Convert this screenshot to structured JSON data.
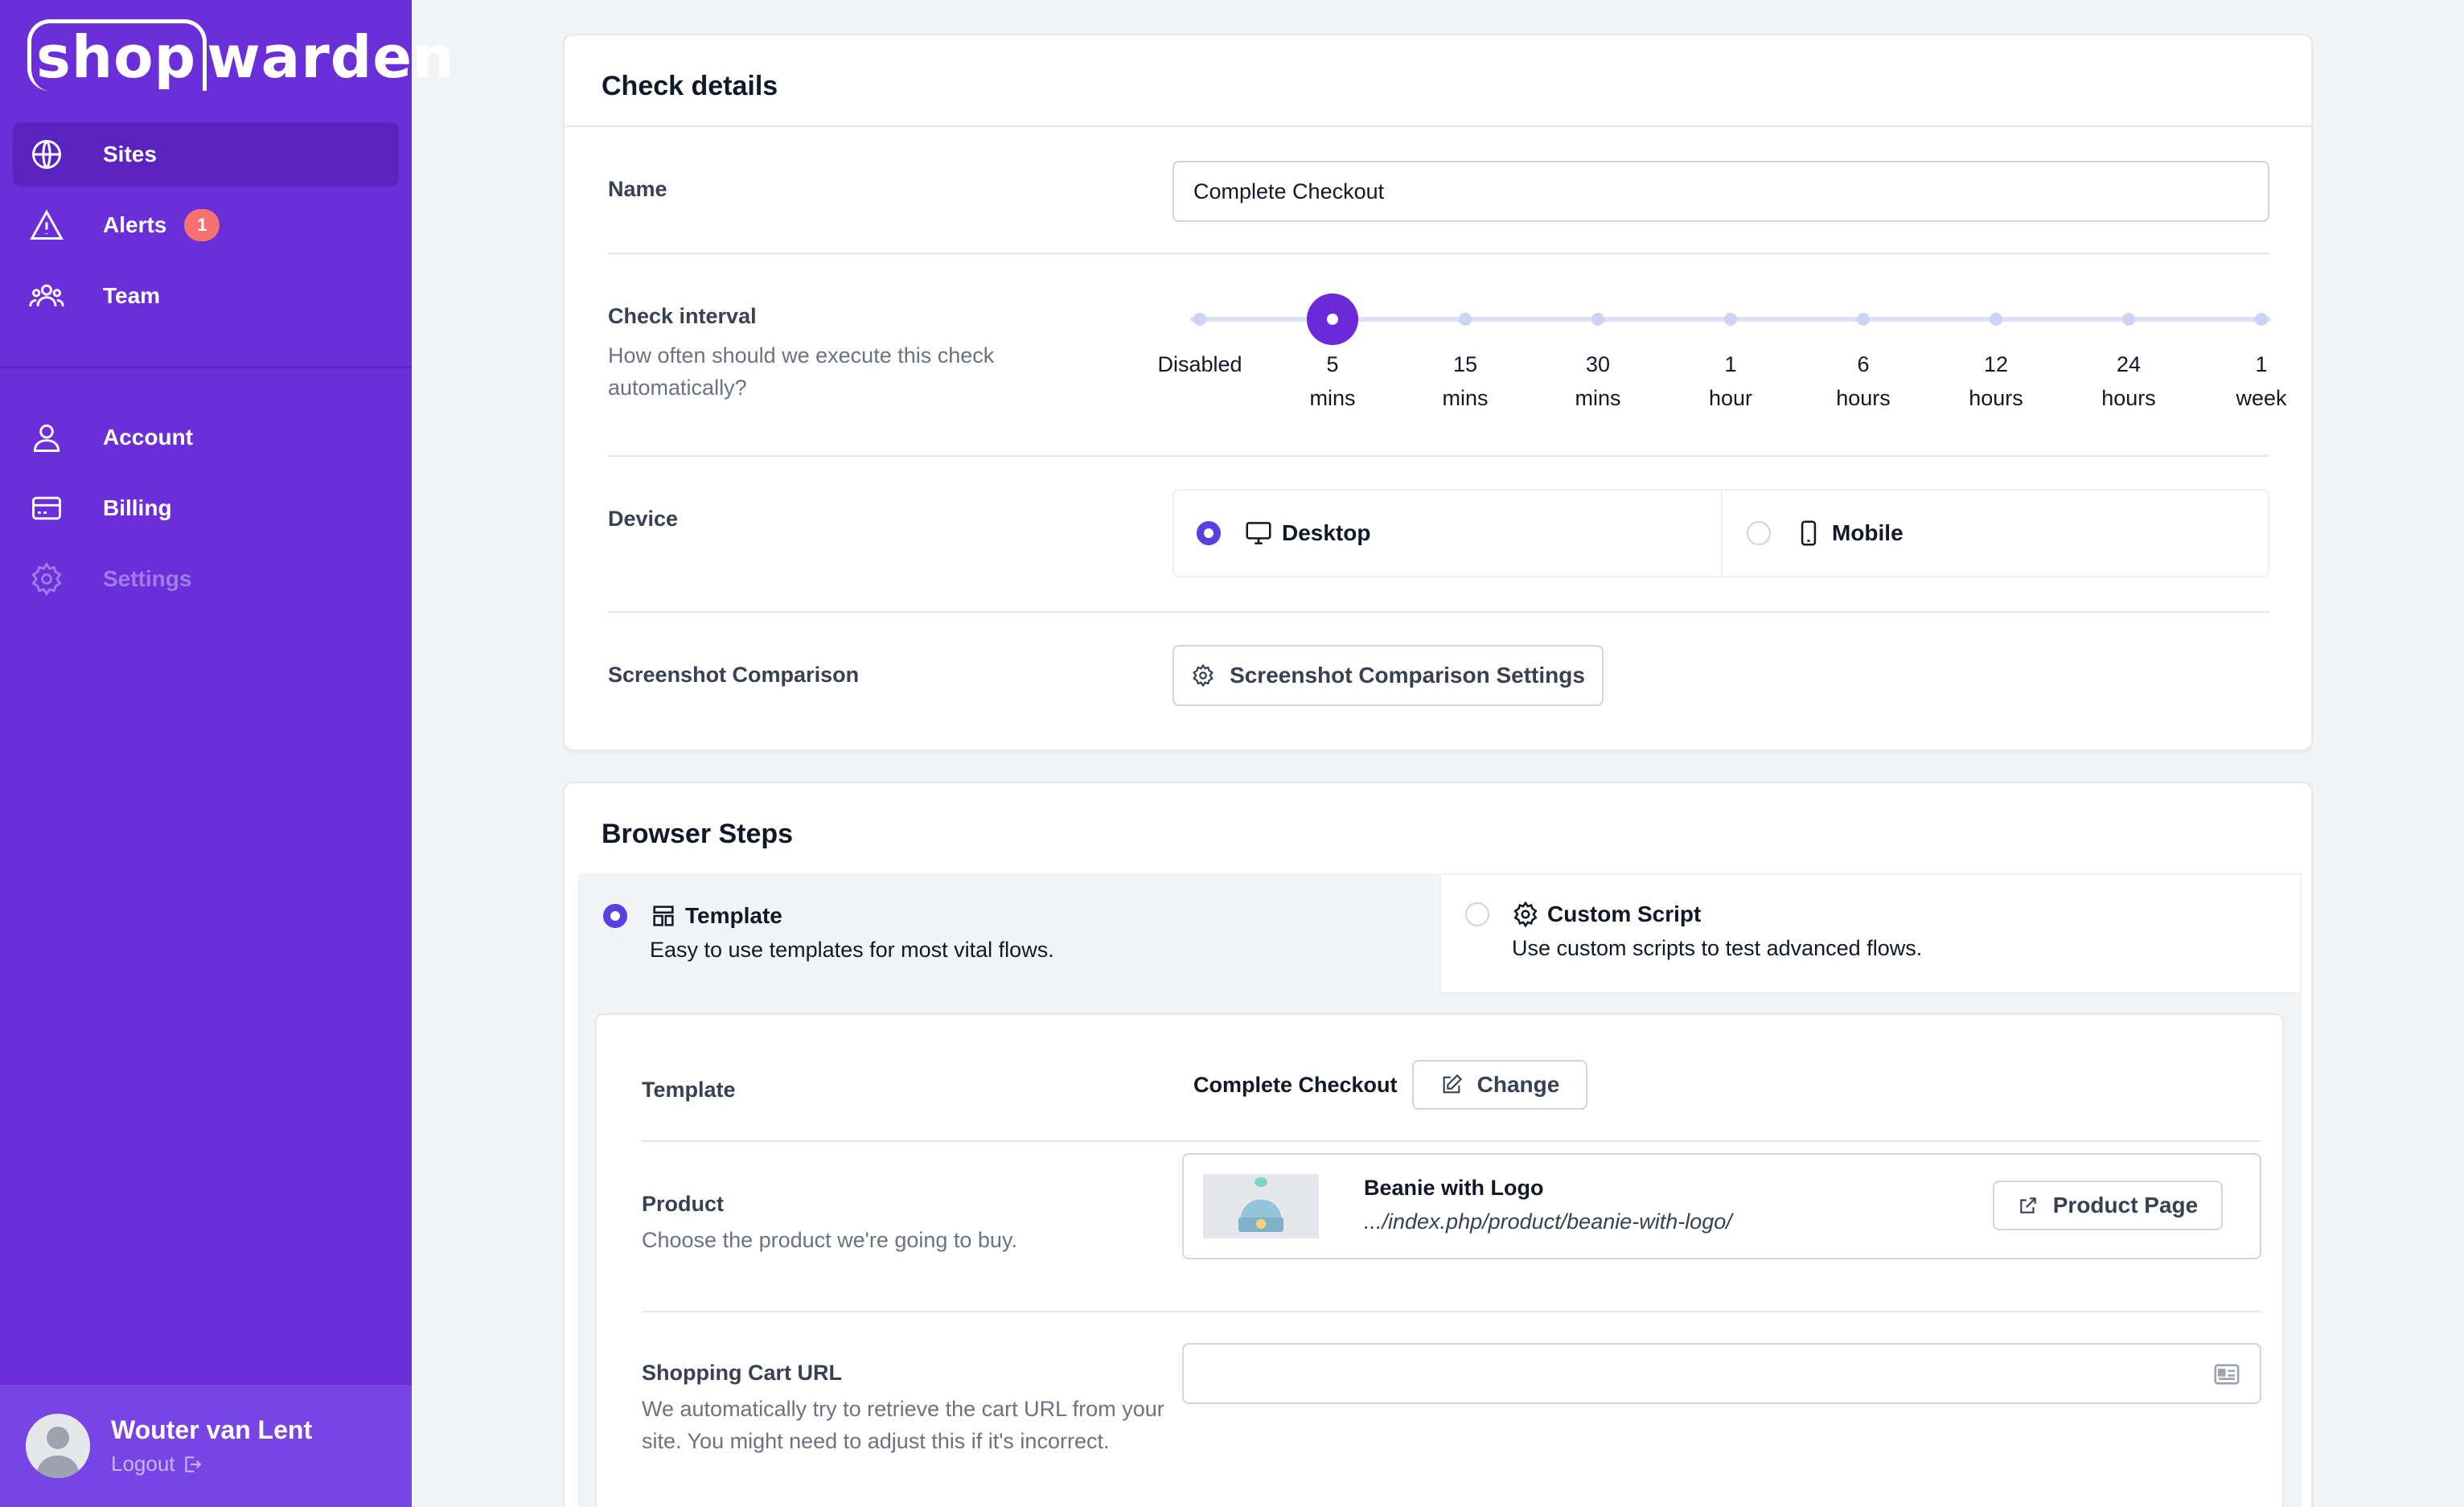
{
  "brand": {
    "logo_text_a": "shop",
    "logo_text_b": "warden"
  },
  "sidebar": {
    "items": [
      {
        "label": "Sites",
        "icon": "globe-icon"
      },
      {
        "label": "Alerts",
        "icon": "warning-icon",
        "badge": "1"
      },
      {
        "label": "Team",
        "icon": "team-icon"
      },
      {
        "label": "Account",
        "icon": "user-icon"
      },
      {
        "label": "Billing",
        "icon": "credit-card-icon"
      },
      {
        "label": "Settings",
        "icon": "gear-icon"
      }
    ],
    "user": {
      "name": "Wouter van Lent",
      "logout": "Logout"
    }
  },
  "check_details": {
    "title": "Check details",
    "name_label": "Name",
    "name_value": "Complete Checkout",
    "interval_label": "Check interval",
    "interval_sub": "How often should we execute this check automatically?",
    "interval_ticks": [
      [
        "Disabled",
        ""
      ],
      [
        "5",
        "mins"
      ],
      [
        "15",
        "mins"
      ],
      [
        "30",
        "mins"
      ],
      [
        "1",
        "hour"
      ],
      [
        "6",
        "hours"
      ],
      [
        "12",
        "hours"
      ],
      [
        "24",
        "hours"
      ],
      [
        "1",
        "week"
      ]
    ],
    "interval_selected_index": 1,
    "device_label": "Device",
    "device_desktop": "Desktop",
    "device_mobile": "Mobile",
    "screenshot_label": "Screenshot Comparison",
    "screenshot_button": "Screenshot Comparison Settings"
  },
  "browser_steps": {
    "title": "Browser Steps",
    "template_tab": {
      "title": "Template",
      "sub": "Easy to use templates for most vital flows."
    },
    "custom_tab": {
      "title": "Custom Script",
      "sub": "Use custom scripts to test advanced flows."
    },
    "template_label": "Template",
    "template_value": "Complete Checkout",
    "change_button": "Change",
    "product_label": "Product",
    "product_sub": "Choose the product we're going to buy.",
    "product_name": "Beanie with Logo",
    "product_url": ".../index.php/product/beanie-with-logo/",
    "product_page_button": "Product Page",
    "cart_label": "Shopping Cart URL",
    "cart_sub": "We automatically try to retrieve the cart URL from your site. You might need to adjust this if it's incorrect.",
    "cart_value": ""
  },
  "colors": {
    "sidebar": "#6b2fd9",
    "accent": "#6d28d9",
    "badge": "#f87171"
  }
}
